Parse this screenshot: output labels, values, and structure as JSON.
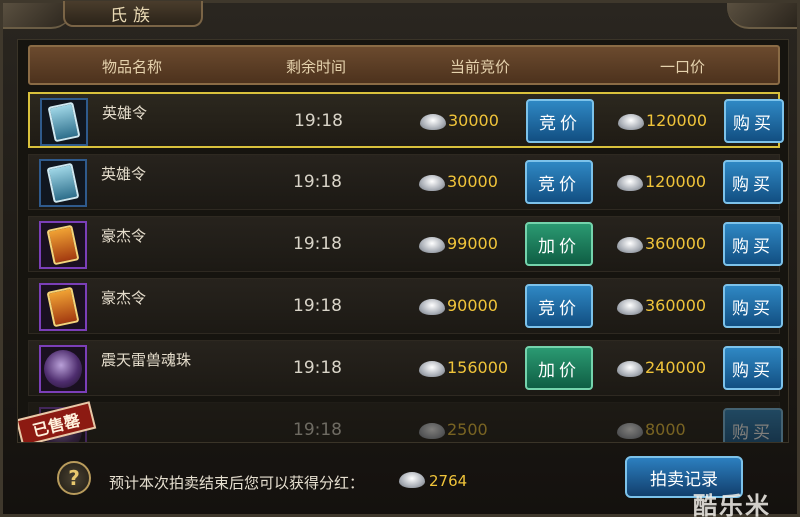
{
  "window": {
    "title": "氏族"
  },
  "table": {
    "headers": {
      "item": "物品名称",
      "time": "剩余时间",
      "current_bid": "当前竞价",
      "buyout": "一口价"
    },
    "rows": [
      {
        "name": "英雄令",
        "icon": "hero-token-icon",
        "time": "19:18",
        "bid": "30000",
        "bid_action": "竞价",
        "buyout": "120000",
        "buy_action": "购买"
      },
      {
        "name": "英雄令",
        "icon": "hero-token-icon",
        "time": "19:18",
        "bid": "30000",
        "bid_action": "竞价",
        "buyout": "120000",
        "buy_action": "购买"
      },
      {
        "name": "豪杰令",
        "icon": "haojie-token-icon",
        "time": "19:18",
        "bid": "99000",
        "bid_action": "加价",
        "buyout": "360000",
        "buy_action": "购买"
      },
      {
        "name": "豪杰令",
        "icon": "haojie-token-icon",
        "time": "19:18",
        "bid": "90000",
        "bid_action": "竞价",
        "buyout": "360000",
        "buy_action": "购买"
      },
      {
        "name": "震天雷兽魂珠",
        "icon": "beast-soul-orb-icon",
        "time": "19:18",
        "bid": "156000",
        "bid_action": "加价",
        "buyout": "240000",
        "buy_action": "购买"
      },
      {
        "name": "",
        "icon": "sold-item-icon",
        "time": "19:18",
        "bid": "2500",
        "buyout": "8000",
        "buy_action": "购买",
        "sold_stamp": "已售罄"
      }
    ]
  },
  "footer": {
    "help": "?",
    "text": "预计本次拍卖结束后您可以获得分红：",
    "amount": "2764",
    "record_button": "拍卖记录"
  },
  "watermark": "酷乐米",
  "colors": {
    "gold_price": "#f0c43a",
    "selected_border": "#d9c13c",
    "blue_button": "#2f88c4",
    "green_button": "#2b9a72"
  }
}
